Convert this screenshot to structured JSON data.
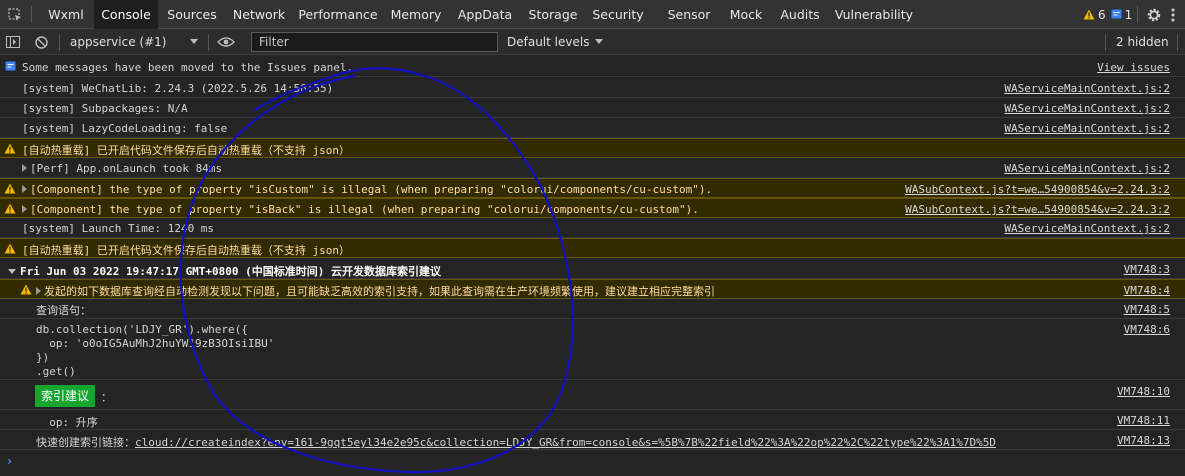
{
  "tabs": [
    "Wxml",
    "Console",
    "Sources",
    "Network",
    "Performance",
    "Memory",
    "AppData",
    "Storage",
    "Security",
    "Sensor",
    "Mock",
    "Audits",
    "Vulnerability"
  ],
  "active_tab": "Console",
  "counts": {
    "warnings": "6",
    "info": "1"
  },
  "toolbar": {
    "context": "appservice (#1)",
    "filter_placeholder": "Filter",
    "levels": "Default levels",
    "hidden": "2 hidden"
  },
  "console": {
    "issues_banner": "Some messages have been moved to the Issues panel.",
    "view_issues": "View issues",
    "rows": [
      {
        "msg": "[system] WeChatLib: 2.24.3 (2022.5.26 14:56:55)",
        "src": "WAServiceMainContext.js:2"
      },
      {
        "msg": "[system] Subpackages: N/A",
        "src": "WAServiceMainContext.js:2"
      },
      {
        "msg": "[system] LazyCodeLoading: false",
        "src": "WAServiceMainContext.js:2"
      },
      {
        "msg": "[自动热重载] 已开启代码文件保存后自动热重载（不支持 json）",
        "src": ""
      },
      {
        "msg": "[Perf] App.onLaunch took 84ms",
        "src": "WAServiceMainContext.js:2"
      },
      {
        "msg": "[Component] the type of property \"isCustom\" is illegal (when preparing \"colorui/components/cu-custom\").",
        "src": "WASubContext.js?t=we…54900854&v=2.24.3:2"
      },
      {
        "msg": "[Component] the type of property \"isBack\" is illegal (when preparing \"colorui/components/cu-custom\").",
        "src": "WASubContext.js?t=we…54900854&v=2.24.3:2"
      },
      {
        "msg": "[system] Launch Time: 1240 ms",
        "src": "WAServiceMainContext.js:2"
      },
      {
        "msg": "[自动热重载] 已开启代码文件保存后自动热重载（不支持 json）",
        "src": ""
      }
    ],
    "group": {
      "title": "Fri Jun 03 2022 19:47:17 GMT+0800 (中国标准时间) 云开发数据库索引建议",
      "src": "VM748:3"
    },
    "group_warn": {
      "msg": "发起的如下数据库查询经自动检测发现以下问题，且可能缺乏高效的索引支持，如果此查询需在生产环境频繁使用，建议建立相应完整索引",
      "src": "VM748:4"
    },
    "query_label": {
      "msg": "查询语句：",
      "src": "VM748:5"
    },
    "query_code": {
      "lines": [
        "db.collection('LDJY_GR').where({",
        "  op: 'o0oIG5AuMhJ2huYW19zB3OIsiIBU'",
        "})",
        ".get()"
      ],
      "src": "VM748:6"
    },
    "index_suggest": {
      "badge": "索引建议",
      "suffix": "：",
      "src": "VM748:10"
    },
    "op_line": {
      "msg": "  op: 升序",
      "src": "VM748:11"
    },
    "quick_link": {
      "label": "快速创建索引链接：",
      "url": "cloud://createindex?env=161-9gqt5eyl34e2e95c&collection=LDJY_GR&from=console&s=%5B%7B%22field%22%3A%22op%22%2C%22type%22%3A1%7D%5D",
      "src": "VM748:13"
    },
    "prompt": "›"
  },
  "colors": {
    "warn_bg": "#332b00",
    "warn_text": "#ffdd9e",
    "badge_green": "#16a630",
    "annotation": "#1010c0"
  }
}
